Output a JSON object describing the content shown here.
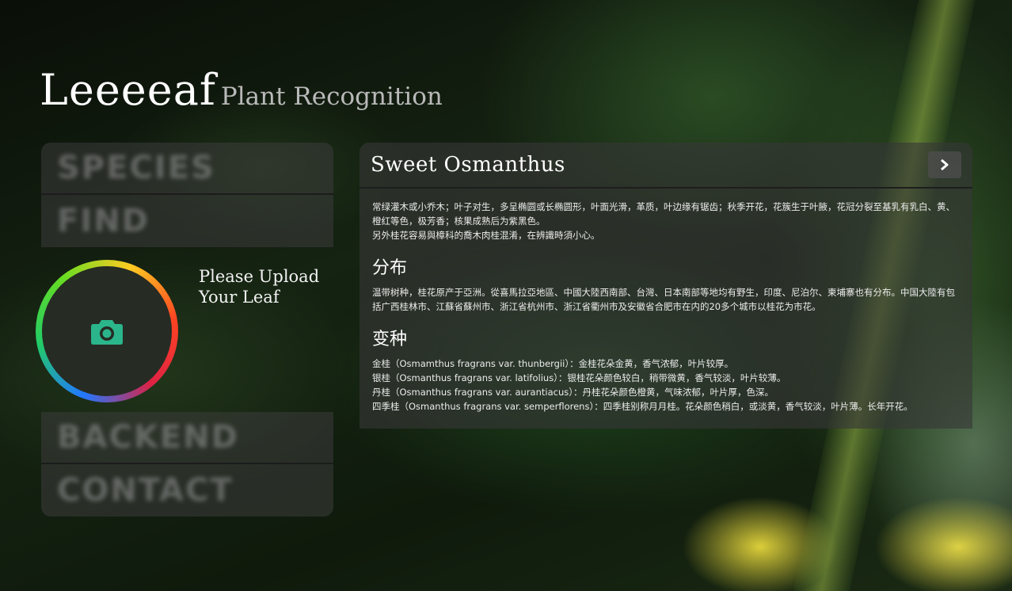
{
  "header": {
    "brand": "Leeeeaf",
    "subtitle": "Plant Recognition"
  },
  "nav": {
    "species": "SPECIES",
    "find": "FIND",
    "backend": "BACKEND",
    "contact": "CONTACT"
  },
  "upload": {
    "line1": "Please Upload",
    "line2": "Your Leaf",
    "icon": "camera-icon"
  },
  "result": {
    "title": "Sweet Osmanthus",
    "next_icon": "chevron-right-icon",
    "intro": [
      "常绿灌木或小乔木；叶子对生，多呈椭圆或长椭圆形，叶面光滑，革质，叶边缘有锯齿；秋季开花，花簇生于叶腋，花冠分裂至基乳有乳白、黄、橙红等色，极芳香；核果成熟后为紫黑色。",
      "另外桂花容易與樟科的喬木肉桂混淆，在辨識時須小心。"
    ],
    "distribution_heading": "分布",
    "distribution": "温带树种，桂花原产于亞洲。從喜馬拉亞地區、中國大陸西南部、台灣、日本南部等地均有野生，印度、尼泊尔、柬埔寨也有分布。中国大陸有包括广西桂林市、江蘇省蘇州市、浙江省杭州市、浙江省衢州市及安徽省合肥市在内的20多个城市以桂花为市花。",
    "variants_heading": "变种",
    "variants": [
      "金桂（Osmamthus fragrans var. thunbergii）：金桂花朵金黄，香气浓郁，叶片较厚。",
      "银桂（Osmanthus fragrans var. latifolius）：银桂花朵颜色较白，稍带微黄，香气较淡，叶片较薄。",
      "丹桂（Osmanthus fragrans var. aurantiacus）：丹桂花朵颜色橙黄，气味浓郁，叶片厚，色深。",
      "四季桂（Osmanthus fragrans var. semperflorens）：四季桂别称月月桂。花朵颜色稍白，或淡黄，香气较淡，叶片薄。长年开花。"
    ]
  },
  "colors": {
    "accent": "#2bb58a",
    "panel": "#373737"
  }
}
